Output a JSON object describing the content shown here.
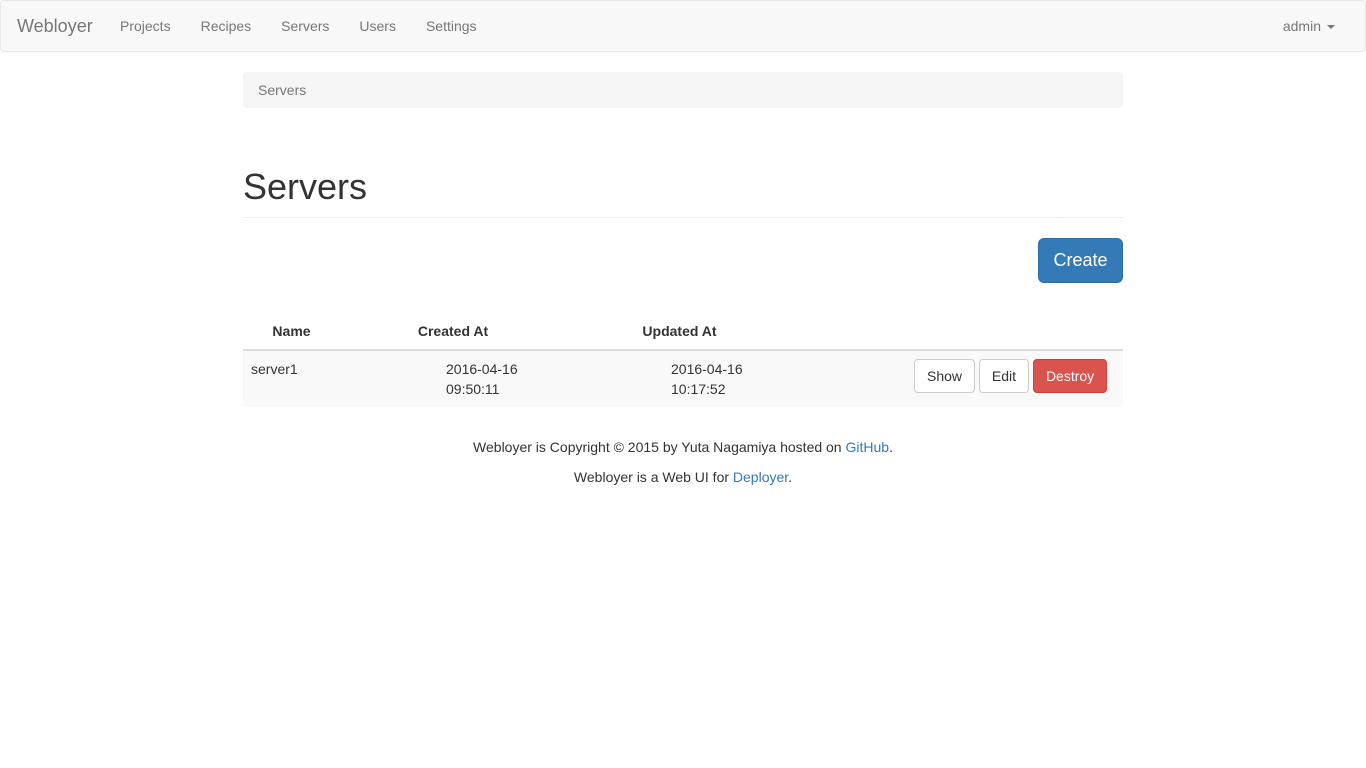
{
  "nav": {
    "brand": "Webloyer",
    "links": [
      "Projects",
      "Recipes",
      "Servers",
      "Users",
      "Settings"
    ],
    "user": "admin"
  },
  "breadcrumb": "Servers",
  "page_title": "Servers",
  "create_label": "Create",
  "table": {
    "headers": [
      "Name",
      "Created At",
      "Updated At"
    ],
    "rows": [
      {
        "name": "server1",
        "created": "2016-04-16 09:50:11",
        "updated": "2016-04-16 10:17:52",
        "show": "Show",
        "edit": "Edit",
        "destroy": "Destroy"
      }
    ]
  },
  "footer": {
    "line1_pre": "Webloyer is Copyright © 2015 by Yuta Nagamiya hosted on ",
    "line1_link": "GitHub",
    "line1_post": ".",
    "line2_pre": "Webloyer is a Web UI for ",
    "line2_link": "Deployer",
    "line2_post": "."
  }
}
